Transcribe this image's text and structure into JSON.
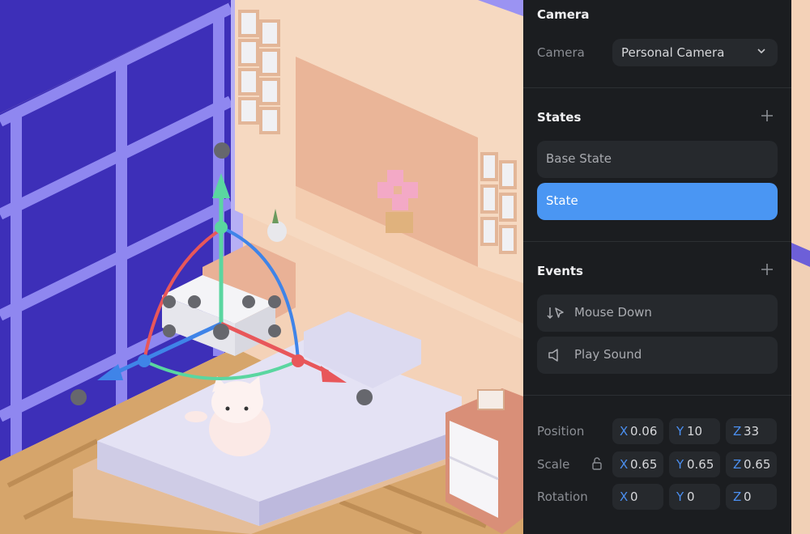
{
  "camera": {
    "section_title": "Camera",
    "label": "Camera",
    "value": "Personal Camera",
    "chevron_icon": "chevron-down-icon"
  },
  "states": {
    "section_title": "States",
    "add_icon": "plus-icon",
    "items": [
      {
        "label": "Base State",
        "active": false
      },
      {
        "label": "State",
        "active": true
      }
    ]
  },
  "events": {
    "section_title": "Events",
    "add_icon": "plus-icon",
    "items": [
      {
        "label": "Mouse Down",
        "icon": "mouse-down-icon"
      },
      {
        "label": "Play Sound",
        "icon": "speaker-icon"
      }
    ]
  },
  "transform": {
    "position": {
      "label": "Position",
      "x": "0.06",
      "y": "10",
      "z": "33"
    },
    "scale": {
      "label": "Scale",
      "lock_icon": "lock-icon",
      "x": "0.65",
      "y": "0.65",
      "z": "0.65"
    },
    "rotation": {
      "label": "Rotation",
      "x": "0",
      "y": "0",
      "z": "0"
    },
    "axis_labels": {
      "x": "X",
      "y": "Y",
      "z": "Z"
    }
  },
  "colors": {
    "accent": "#4a96f3",
    "panel_bg": "#1b1d20",
    "field_bg": "#26292d",
    "axis_x": "#e8575a",
    "axis_y": "#5ad6a0",
    "axis_z": "#3f84e8"
  }
}
